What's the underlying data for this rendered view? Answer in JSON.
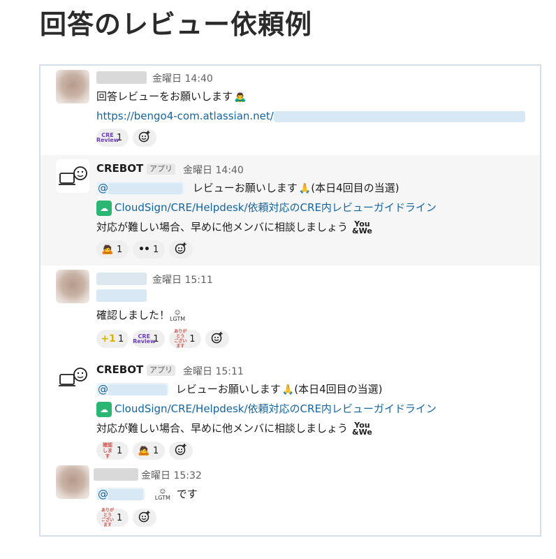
{
  "page": {
    "title": "回答のレビュー依頼例"
  },
  "messages": [
    {
      "time": "金曜日 14:40",
      "text": "回答レビューをお願いします",
      "text_emoji": "man-bowing-emoji",
      "link": "https://bengo4-com.atlassian.net/",
      "reactions": [
        {
          "icon": "CRE\nReview",
          "icon_name": "cre-review-emoji",
          "count": "1"
        }
      ]
    },
    {
      "sender": "CREBOT",
      "app_badge": "アプリ",
      "time": "金曜日 14:40",
      "mention_prefix": "@",
      "request_text": "レビューお願いします",
      "request_suffix": "(本日4回目の当選)",
      "guide_link": "CloudSign/CRE/Helpdesk/依頼対応のCRE内レビューガイドライン",
      "note": "対応が難しい場合、早めに他メンバに相談しましょう",
      "you_we": "You\n&We",
      "reactions": [
        {
          "icon": "🙇",
          "icon_name": "bowing-emoji",
          "count": "1"
        },
        {
          "icon": "••",
          "icon_name": "eyes-emoji",
          "count": "1"
        }
      ]
    },
    {
      "time": "金曜日 15:11",
      "text": "確認しました！",
      "text_emoji": "LGTM",
      "reactions": [
        {
          "icon": "+1",
          "icon_name": "plus-one-emoji",
          "count": "1"
        },
        {
          "icon": "CRE\nReview",
          "icon_name": "cre-review-emoji",
          "count": "1"
        },
        {
          "icon": "ありがとう\nございます",
          "icon_name": "arigatou-emoji",
          "count": "1"
        }
      ]
    },
    {
      "sender": "CREBOT",
      "app_badge": "アプリ",
      "time": "金曜日 15:11",
      "mention_prefix": "@",
      "request_text": "レビューお願いします",
      "request_suffix": "(本日4回目の当選)",
      "guide_link": "CloudSign/CRE/Helpdesk/依頼対応のCRE内レビューガイドライン",
      "note": "対応が難しい場合、早めに他メンバに相談しましょう",
      "you_we": "You\n&We",
      "reactions": [
        {
          "icon": "確認\nします",
          "icon_name": "kakunin-shimasu-emoji",
          "count": "1"
        },
        {
          "icon": "🙇",
          "icon_name": "bowing-emoji",
          "count": "1"
        }
      ]
    },
    {
      "time": "金曜日 15:32",
      "mention_prefix": "@",
      "text": "です",
      "text_emoji": "LGTM",
      "reactions": [
        {
          "icon": "ありがとう\nございます",
          "icon_name": "arigatou-emoji",
          "count": "1"
        }
      ]
    }
  ],
  "icons": {
    "add_reaction": "add-reaction-icon",
    "pray": "🙏",
    "bot_avatar": "crebot-avatar"
  }
}
